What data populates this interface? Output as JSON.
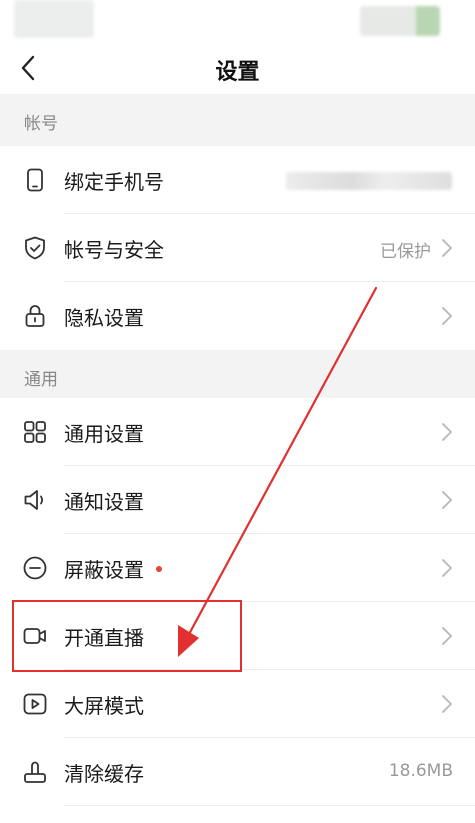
{
  "nav": {
    "title": "设置"
  },
  "sections": {
    "account": {
      "title": "帐号"
    },
    "general": {
      "title": "通用"
    }
  },
  "rows": {
    "bind_phone": {
      "label": "绑定手机号",
      "icon": "phone-icon"
    },
    "account_security": {
      "label": "帐号与安全",
      "value": "已保护",
      "icon": "shield-check-icon"
    },
    "privacy": {
      "label": "隐私设置",
      "icon": "lock-icon"
    },
    "general_settings": {
      "label": "通用设置",
      "icon": "grid-icon"
    },
    "notifications": {
      "label": "通知设置",
      "icon": "speaker-icon"
    },
    "block_settings": {
      "label": "屏蔽设置",
      "icon": "minus-circle-icon",
      "badge": "red-dot"
    },
    "go_live": {
      "label": "开通直播",
      "icon": "video-camera-icon"
    },
    "big_screen": {
      "label": "大屏模式",
      "icon": "play-square-icon"
    },
    "clear_cache": {
      "label": "清除缓存",
      "value": "18.6MB",
      "icon": "broom-icon"
    }
  },
  "colors": {
    "annotation": "#e03030",
    "badge": "#e8413b",
    "section_bg": "#f3f3f3"
  }
}
